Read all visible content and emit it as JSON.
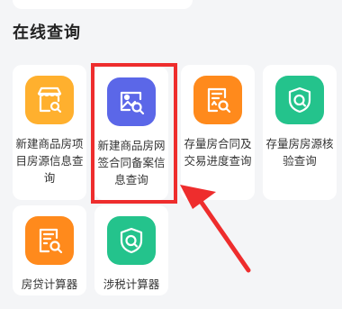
{
  "section": {
    "title": "在线查询"
  },
  "items": [
    {
      "label": "新建商品房项目房源信息查询",
      "icon": "shop-search-icon",
      "color": "#ffb02e"
    },
    {
      "label": "新建商品房网签合同备案信息查询",
      "icon": "image-search-icon",
      "color": "#5b67e8"
    },
    {
      "label": "存量房合同及交易进度查询",
      "icon": "contract-search-icon",
      "color": "#ff8a1c"
    },
    {
      "label": "存量房房源核验查询",
      "icon": "shield-search-icon",
      "color": "#24c38c"
    },
    {
      "label": "房贷计算器",
      "icon": "document-search-icon",
      "color": "#ff8a1c"
    },
    {
      "label": "涉税计算器",
      "icon": "shield-search-icon",
      "color": "#24c38c"
    }
  ],
  "highlight": {
    "color": "#ee2d2d"
  }
}
